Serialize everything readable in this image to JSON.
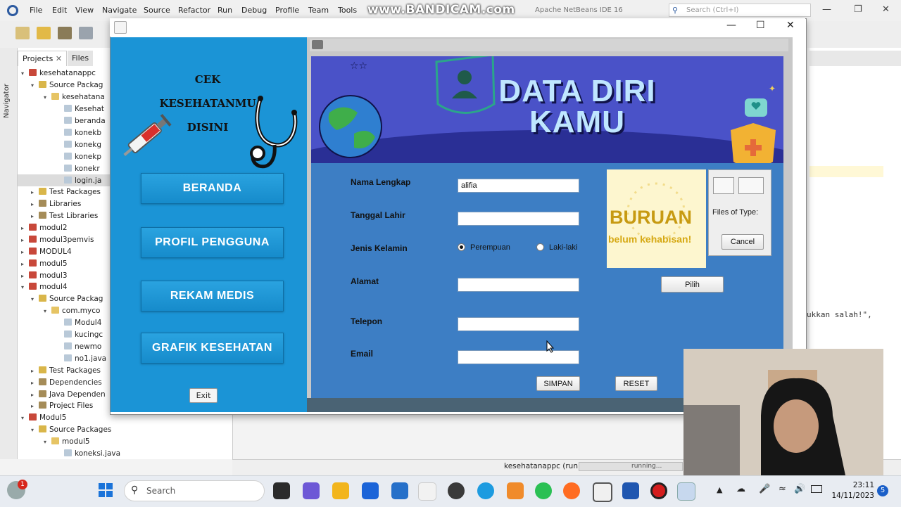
{
  "ide": {
    "menu": [
      "File",
      "Edit",
      "View",
      "Navigate",
      "Source",
      "Refactor",
      "Run",
      "Debug",
      "Profile",
      "Team",
      "Tools"
    ],
    "watermark": "www.BANDICAM.com",
    "title": "Apache NetBeans IDE 16",
    "search_placeholder": "Search (Ctrl+I)",
    "tabs": [
      "Projects",
      "Files"
    ],
    "navigator_label": "Navigator",
    "tree": [
      "kesehatanappc",
      "Source Packag",
      "kesehatana",
      "Kesehat",
      "beranda",
      "konekb",
      "konekg",
      "konekp",
      "konekr",
      "login.ja",
      "Test Packages",
      "Libraries",
      "Test Libraries",
      "modul2",
      "modul3pemvis",
      "MODUL4",
      "modul5",
      "modul3",
      "modul4",
      "Source Packag",
      "com.myco",
      "Modul4",
      "kucingc",
      "newmo",
      "no1.java",
      "Test Packages",
      "Dependencies",
      "Java Dependen",
      "Project Files",
      "Modul5",
      "Source Packages",
      "modul5",
      "koneksi.java"
    ],
    "code_snippet": "ukkan salah!\",",
    "status_run": "kesehatanappc (run)",
    "status_progress_text": "running..."
  },
  "app": {
    "sidebar_title_lines": [
      "CEK",
      "KESEHATANMU",
      "DISINI"
    ],
    "nav": [
      "BERANDA",
      "PROFIL PENGGUNA",
      "REKAM MEDIS",
      "GRAFIK KESEHATAN"
    ],
    "exit_label": "Exit",
    "banner_title_lines": [
      "DATA DIRI",
      "KAMU"
    ],
    "form": {
      "labels": {
        "nama": "Nama Lengkap",
        "tanggal": "Tanggal Lahir",
        "jenis": "Jenis Kelamin",
        "alamat": "Alamat",
        "telepon": "Telepon",
        "email": "Email"
      },
      "values": {
        "nama": "alifia",
        "tanggal": "",
        "alamat": "",
        "telepon": "",
        "email": ""
      },
      "gender_options": [
        "Perempuan",
        "Laki-laki"
      ],
      "gender_selected": "Perempuan"
    },
    "promo": {
      "big": "BURUAN",
      "sub": "belum kehabisan!"
    },
    "file_chooser": {
      "files_of_type": "Files of Type:",
      "cancel": "Cancel"
    },
    "pilih_label": "Pilih",
    "simpan_label": "SIMPAN",
    "reset_label": "RESET"
  },
  "taskbar": {
    "search_placeholder": "Search",
    "time": "23:11",
    "date": "14/11/2023",
    "notification_count": "5",
    "update_badge": "1"
  }
}
